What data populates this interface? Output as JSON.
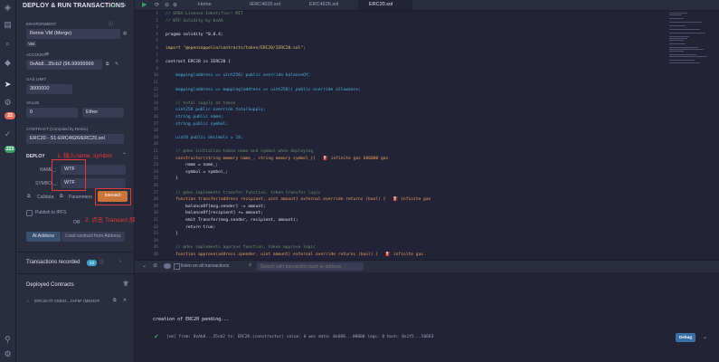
{
  "rail": {
    "badges": [
      {
        "text": "22",
        "color": "#e36f5b"
      },
      {
        "text": "223",
        "color": "#3aa06a"
      }
    ]
  },
  "panel": {
    "title": "DEPLOY & RUN TRANSACTIONS",
    "environment_label": "ENVIRONMENT",
    "environment_value": "Remix VM (Merge)",
    "vm_badge": "VM",
    "account_label": "ACCOUNT",
    "account_value": "0xAb8...35cb2 (96.99999999",
    "gas_label": "GAS LIMIT",
    "gas_value": "3000000",
    "value_label": "VALUE",
    "value_amount": "0",
    "value_unit": "Ether",
    "contract_label": "CONTRACT (Compiled by Remix)",
    "contract_value": "ERC20 - S1-ERC4626/ERC20.sol",
    "deploy_label": "DEPLOY",
    "name_label": "NAME_:",
    "name_value": "WTF",
    "symbol_label": "SYMBOL_:",
    "symbol_value": "WTF",
    "calldata_label": "Calldata",
    "parameters_label": "Parameters",
    "transact_label": "transact",
    "publish_label": "Publish to IPFS",
    "or_label": "OR",
    "at_address_label": "At Address",
    "load_contract_label": "Load contract from Address",
    "transactions_label": "Transactions recorded",
    "transactions_count": "23",
    "deployed_label": "Deployed Contracts",
    "deployed_item": "ERC20 AT 0XB34...2AF5F (MEMOF"
  },
  "annotations": {
    "step1": "1. 输入name, symbol",
    "step2": "2. 点击 Transact 部署"
  },
  "tabs": [
    {
      "label": "Home",
      "active": false
    },
    {
      "label": "IERC4626.sol",
      "active": false
    },
    {
      "label": "ERC4626.sol",
      "active": false
    },
    {
      "label": "ERC20.sol",
      "active": true
    }
  ],
  "code": [
    {
      "n": "1",
      "text": "// SPDX-License-Identifier: MIT",
      "cls": "c"
    },
    {
      "n": "2",
      "text": "// WTF Solidity by 0xAA",
      "cls": "c"
    },
    {
      "n": "3",
      "text": "",
      "cls": ""
    },
    {
      "n": "4",
      "text": "pragma solidity ^0.8.4;",
      "cls": ""
    },
    {
      "n": "5",
      "text": "",
      "cls": ""
    },
    {
      "n": "6",
      "text": "import \"@openzeppelin/contracts/token/ERC20/IERC20.sol\";",
      "cls": "s"
    },
    {
      "n": "7",
      "text": "",
      "cls": ""
    },
    {
      "n": "8",
      "text": "contract ERC20 is IERC20 {",
      "cls": ""
    },
    {
      "n": "9",
      "text": "",
      "cls": ""
    },
    {
      "n": "10",
      "text": "    mapping(address => uint256) public override balanceOf;",
      "cls": "t"
    },
    {
      "n": "11",
      "text": "",
      "cls": ""
    },
    {
      "n": "12",
      "text": "    mapping(address => mapping(address => uint256)) public override allowance;",
      "cls": "t"
    },
    {
      "n": "13",
      "text": "",
      "cls": ""
    },
    {
      "n": "14",
      "text": "    // total supply at token",
      "cls": "c"
    },
    {
      "n": "15",
      "text": "    uint256 public override totalSupply;",
      "cls": "t"
    },
    {
      "n": "16",
      "text": "    string public name;",
      "cls": "t"
    },
    {
      "n": "17",
      "text": "    string public symbol;",
      "cls": "t"
    },
    {
      "n": "18",
      "text": "",
      "cls": ""
    },
    {
      "n": "19",
      "text": "    uint8 public decimals = 18;",
      "cls": "t"
    },
    {
      "n": "20",
      "text": "",
      "cls": ""
    },
    {
      "n": "21",
      "text": "    // @dev initialize token name and symbol when deploying",
      "cls": "c"
    },
    {
      "n": "22",
      "text": "    constructor(string memory name_, string memory symbol_){   ⛽ infinite gas 606000 gas",
      "cls": "fn"
    },
    {
      "n": "23",
      "text": "        name = name_;",
      "cls": ""
    },
    {
      "n": "24",
      "text": "        symbol = symbol_;",
      "cls": ""
    },
    {
      "n": "25",
      "text": "    }",
      "cls": ""
    },
    {
      "n": "26",
      "text": "",
      "cls": ""
    },
    {
      "n": "27",
      "text": "    // @dev implements transfer function, token transfer logic",
      "cls": "c"
    },
    {
      "n": "28",
      "text": "    function transfer(address recipient, uint amount) external override returns (bool) {   ⛽ infinite gas",
      "cls": "fn"
    },
    {
      "n": "29",
      "text": "        balanceOf[msg.sender] -= amount;",
      "cls": ""
    },
    {
      "n": "30",
      "text": "        balanceOf[recipient] += amount;",
      "cls": ""
    },
    {
      "n": "31",
      "text": "        emit Transfer(msg.sender, recipient, amount);",
      "cls": ""
    },
    {
      "n": "32",
      "text": "        return true;",
      "cls": ""
    },
    {
      "n": "33",
      "text": "    }",
      "cls": ""
    },
    {
      "n": "34",
      "text": "",
      "cls": ""
    },
    {
      "n": "35",
      "text": "    // @dev implements approve function, token approve logic",
      "cls": "c"
    },
    {
      "n": "36",
      "text": "    function approve(address spender, uint amount) external override returns (bool) {   ⛽ infinite gas",
      "cls": "fn"
    }
  ],
  "terminal": {
    "listen_label": "listen on all transactions",
    "search_placeholder": "Search with transaction hash or address",
    "pending": "creation of ERC20 pending...",
    "log": "[vm] from: 0xAb8...35cb2 to: ERC20.(constructor) value: 0 wei data: 0x608...00000 logs: 0 hash: 0x1f5...56663",
    "debug_label": "Debug"
  }
}
